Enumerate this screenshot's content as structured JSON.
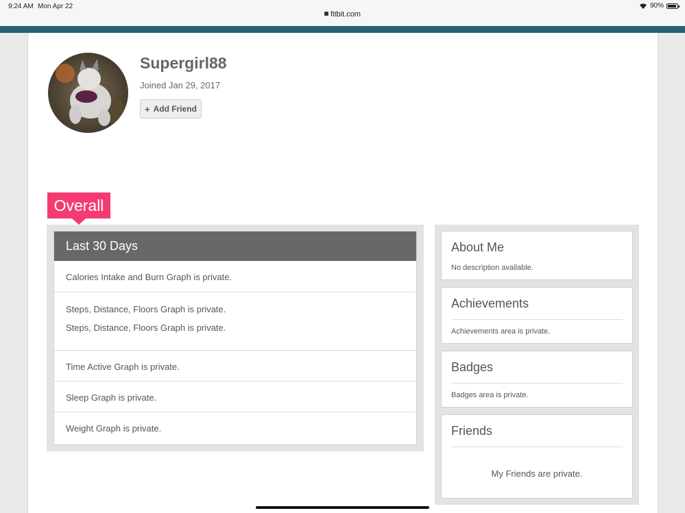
{
  "status_bar": {
    "time": "9:24 AM",
    "date": "Mon Apr 22",
    "url": "fitbit.com",
    "battery": "90%",
    "battery_level": 0.9
  },
  "profile": {
    "name": "Supergirl88",
    "joined": "Joined Jan 29, 2017",
    "add_friend_label": "Add Friend"
  },
  "section_tag": "Overall",
  "last30": {
    "heading": "Last 30 Days",
    "rows": [
      "Calories Intake and Burn Graph is private.",
      "Steps, Distance, Floors Graph is private.",
      "Steps, Distance, Floors Graph is private.",
      "Time Active Graph is private.",
      "Sleep Graph is private.",
      "Weight Graph is private."
    ]
  },
  "sidebar": {
    "about": {
      "title": "About Me",
      "text": "No description available."
    },
    "achievements": {
      "title": "Achievements",
      "text": "Achievements area is private."
    },
    "badges": {
      "title": "Badges",
      "text": "Badges area is private."
    },
    "friends": {
      "title": "Friends",
      "text": "My Friends are private."
    }
  },
  "colors": {
    "topbar": "#2a6276",
    "tag": "#f43b71",
    "panel_header": "#686868"
  }
}
